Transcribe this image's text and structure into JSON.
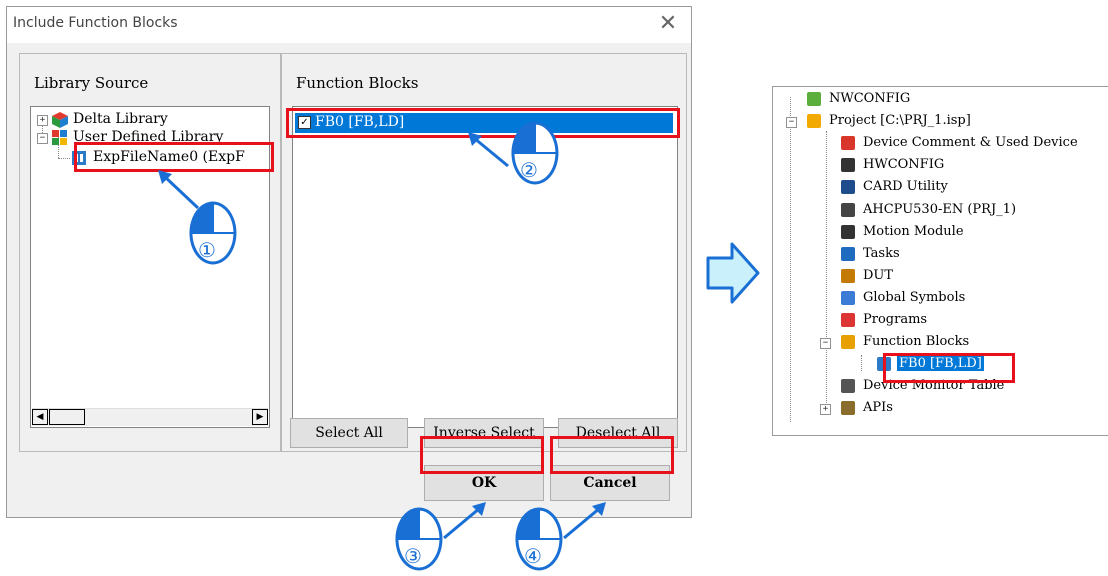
{
  "dialog": {
    "title": "Include Function Blocks",
    "library_source_label": "Library Source",
    "function_blocks_label": "Function Blocks",
    "library_tree": [
      {
        "label": "Delta Library",
        "expander": "+",
        "icon": "cube-icon"
      },
      {
        "label": "User Defined Library",
        "expander": "−",
        "icon": "library-icon"
      },
      {
        "label": "ExpFileName0 (ExpF",
        "icon": "file-module-icon"
      }
    ],
    "function_block_items": [
      {
        "label": "FB0 [FB,LD]",
        "checked": true
      }
    ],
    "buttons": {
      "select_all": "Select All",
      "inverse_select": "Inverse Select",
      "deselect_all": "Deselect All",
      "ok": "OK",
      "cancel": "Cancel"
    }
  },
  "callouts": [
    "①",
    "②",
    "③",
    "④"
  ],
  "project_tree": [
    {
      "label": "NWCONFIG",
      "icon": "network-config-icon"
    },
    {
      "label": "Project [C:\\PRJ_1.isp]",
      "icon": "project-folder-icon"
    },
    {
      "label": "Device Comment & Used Device",
      "icon": "device-comment-icon"
    },
    {
      "label": "HWCONFIG",
      "icon": "hardware-config-icon"
    },
    {
      "label": "CARD Utility",
      "icon": "card-icon"
    },
    {
      "label": "AHCPU530-EN  (PRJ_1)",
      "icon": "cpu-icon"
    },
    {
      "label": "Motion Module",
      "icon": "motion-module-icon"
    },
    {
      "label": "Tasks",
      "icon": "tasks-icon"
    },
    {
      "label": "DUT",
      "icon": "dut-icon"
    },
    {
      "label": "Global Symbols",
      "icon": "global-symbols-icon"
    },
    {
      "label": "Programs",
      "icon": "programs-icon"
    },
    {
      "label": "Function Blocks",
      "icon": "function-blocks-icon"
    },
    {
      "label": "FB0 [FB,LD]",
      "icon": "fb-icon"
    },
    {
      "label": "Device Monitor Table",
      "icon": "monitor-table-icon"
    },
    {
      "label": "APIs",
      "icon": "apis-icon"
    }
  ],
  "colors": {
    "highlight": "#e8101b",
    "selection": "#0078d7",
    "callout_blue": "#1a6fd4",
    "arrow_fill": "#c9f0fb"
  }
}
